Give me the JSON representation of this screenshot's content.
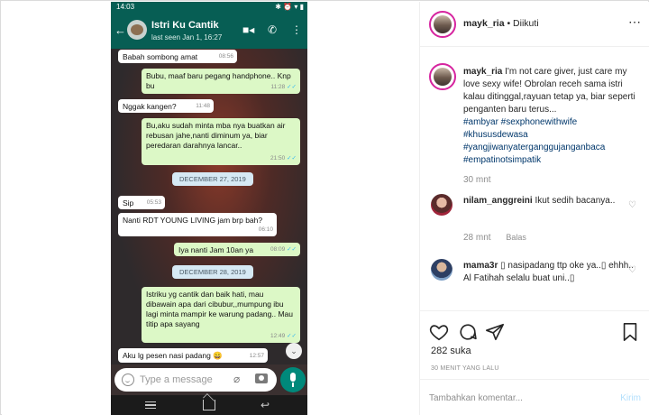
{
  "phone": {
    "status_time": "14:03",
    "contact_name": "Istri Ku Cantik",
    "last_seen": "last seen Jan 1, 16:27",
    "input_placeholder": "Type a message",
    "messages": [
      {
        "dir": "in",
        "text": "Babah sombong amat",
        "time": "08:56"
      },
      {
        "dir": "out",
        "text": "Bubu, maaf baru pegang handphone.. Knp bu",
        "time": "11:28"
      },
      {
        "dir": "in",
        "text": "Nggak kangen?",
        "time": "11:48"
      },
      {
        "dir": "out",
        "text": "Bu,aku sudah minta mba nya buatkan air rebusan jahe,nanti diminum ya, biar peredaran darahnya lancar..",
        "time": "21:50"
      },
      {
        "dir": "date",
        "text": "DECEMBER 27, 2019"
      },
      {
        "dir": "in",
        "text": "Sip",
        "time": "05:53"
      },
      {
        "dir": "in",
        "text": "Nanti RDT YOUNG LIVING jam brp bah?",
        "time": "06:10"
      },
      {
        "dir": "out",
        "text": "Iya nanti Jam 10an ya",
        "time": "08:09"
      },
      {
        "dir": "date",
        "text": "DECEMBER 28, 2019"
      },
      {
        "dir": "out",
        "text": "Istriku yg cantik dan baik hati, mau dibawain apa dari cibubur,,mumpung ibu lagi minta mampir ke warung padang..  Mau titip apa sayang",
        "time": "12:49"
      },
      {
        "dir": "in",
        "text": "Aku lg pesen nasi padang 😄",
        "time": "12:57"
      }
    ]
  },
  "post": {
    "username": "mayk_ria",
    "follow_status": "• Diikuti",
    "more_icon": "more-horizontal-icon",
    "caption_user": "mayk_ria",
    "caption_text": "I'm not care giver, just care my love sexy wife! Obrolan receh sama istri kalau ditinggal,rayuan tetap ya, biar seperti penganten baru terus...",
    "hashtags": [
      "#ambyar #sexphonewithwife",
      "#khususdewasa",
      "#yangjiwanyaterganggujanganbaca",
      "#empatinotsimpatik"
    ],
    "caption_time": "30 mnt",
    "comments": [
      {
        "user": "nilam_anggreini",
        "text": "Ikut sedih bacanya..",
        "time": "28 mnt",
        "reply": "Balas"
      },
      {
        "user": "mama3r",
        "text": "▯ nasipadang ttp oke ya..▯ ehhh.. Al Fatihah selalu buat uni..▯",
        "time": ""
      }
    ],
    "likes": "282 suka",
    "time_ago": "30 MENIT YANG LALU",
    "add_comment_placeholder": "Tambahkan komentar...",
    "post_button": "Kirim"
  }
}
